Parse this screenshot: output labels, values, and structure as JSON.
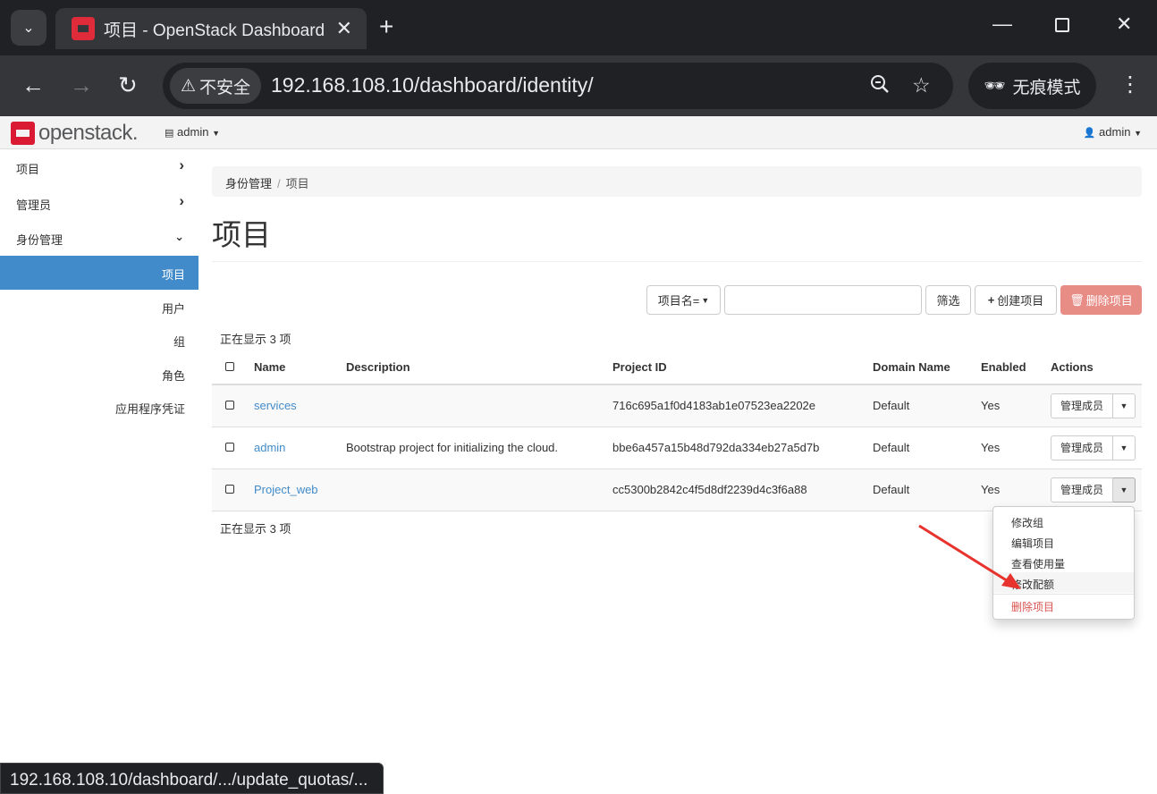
{
  "browser": {
    "tab_title": "项目 - OpenStack Dashboard",
    "security_label": "不安全",
    "url": "192.168.108.10/dashboard/identity/",
    "incognito_label": "无痕模式",
    "status_url": "192.168.108.10/dashboard/.../update_quotas/..."
  },
  "header": {
    "logo_text_a": "open",
    "logo_text_b": "stack.",
    "project_selector": "admin",
    "user_menu": "admin"
  },
  "sidebar": {
    "items": [
      {
        "label": "项目"
      },
      {
        "label": "管理员"
      },
      {
        "label": "身份管理"
      }
    ],
    "sub_items": [
      {
        "label": "项目"
      },
      {
        "label": "用户"
      },
      {
        "label": "组"
      },
      {
        "label": "角色"
      },
      {
        "label": "应用程序凭证"
      }
    ]
  },
  "breadcrumb": {
    "parent": "身份管理",
    "current": "项目"
  },
  "page_title": "项目",
  "toolbar": {
    "filter_field": "项目名=",
    "filter_button": "筛选",
    "create_button": "创建项目",
    "delete_button": "删除项目"
  },
  "count_text": "正在显示 3 项",
  "table": {
    "headers": [
      "Name",
      "Description",
      "Project ID",
      "Domain Name",
      "Enabled",
      "Actions"
    ],
    "rows": [
      {
        "name": "services",
        "description": "",
        "id": "716c695a1f0d4183ab1e07523ea2202e",
        "domain": "Default",
        "enabled": "Yes",
        "action": "管理成员"
      },
      {
        "name": "admin",
        "description": "Bootstrap project for initializing the cloud.",
        "id": "bbe6a457a15b48d792da334eb27a5d7b",
        "domain": "Default",
        "enabled": "Yes",
        "action": "管理成员"
      },
      {
        "name": "Project_web",
        "description": "",
        "id": "cc5300b2842c4f5d8df2239d4c3f6a88",
        "domain": "Default",
        "enabled": "Yes",
        "action": "管理成员"
      }
    ]
  },
  "dropdown": {
    "items": [
      "修改组",
      "编辑项目",
      "查看使用量",
      "修改配额",
      "删除项目"
    ]
  },
  "colors": {
    "accent": "#428bca",
    "brand": "#da1a32",
    "danger": "#d9534f",
    "annotation": "#e8322d"
  }
}
